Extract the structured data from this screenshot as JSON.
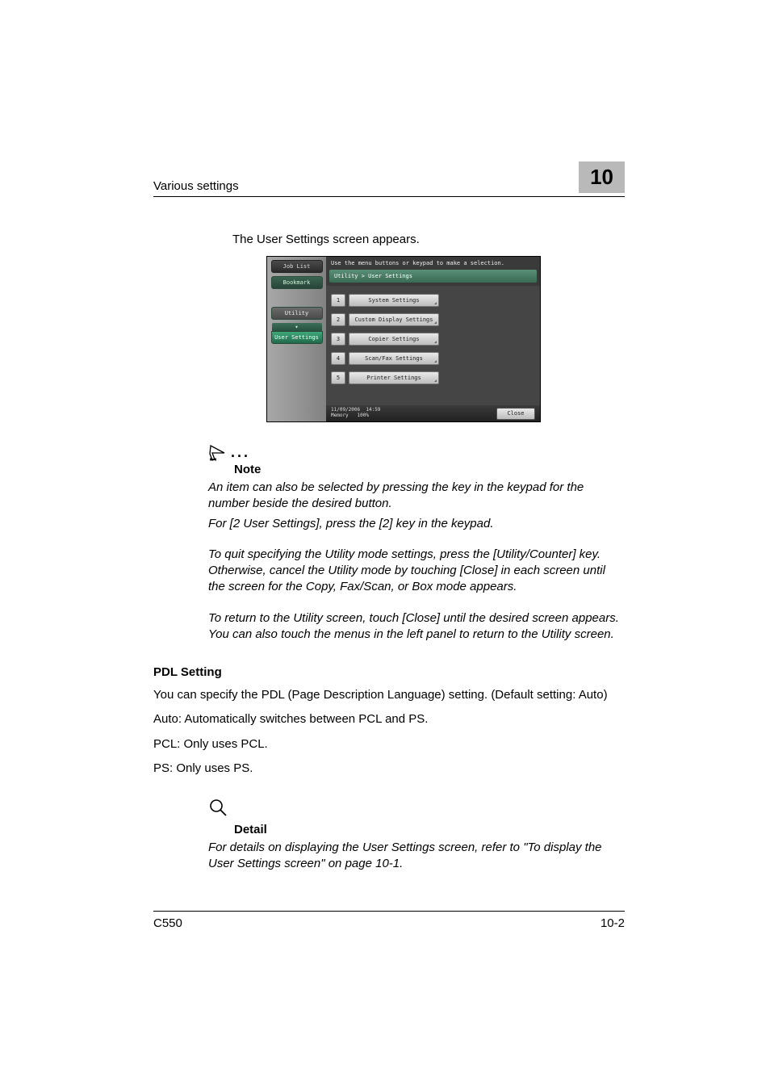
{
  "header": {
    "left": "Various settings",
    "right": "10"
  },
  "intro": "The User Settings screen appears.",
  "screenshot": {
    "left_tabs": {
      "job_list": "Job List",
      "bookmark": "Bookmark",
      "utility": "Utility",
      "arrow": "▾",
      "user_settings": "User Settings"
    },
    "topbar": "Use the menu buttons or keypad to make a selection.",
    "breadcrumb": "Utility > User Settings",
    "menu": [
      {
        "num": "1",
        "label": "System Settings"
      },
      {
        "num": "2",
        "label": "Custom Display Settings"
      },
      {
        "num": "3",
        "label": "Copier Settings"
      },
      {
        "num": "4",
        "label": "Scan/Fax Settings"
      },
      {
        "num": "5",
        "label": "Printer Settings"
      }
    ],
    "footer": {
      "date": "11/09/2006",
      "time": "14:59",
      "mem_label": "Memory",
      "mem_val": "100%",
      "close": "Close"
    }
  },
  "note": {
    "label": "Note",
    "p1": "An item can also be selected by pressing the key in the keypad for the number beside the desired button.",
    "p2": "For [2 User Settings], press the [2] key in the keypad.",
    "p3": "To quit specifying the Utility mode settings, press the [Utility/Counter] key. Otherwise, cancel the Utility mode by touching [Close] in each screen until the screen for the Copy, Fax/Scan, or Box mode appears.",
    "p4": "To return to the Utility screen, touch [Close] until the desired screen appears. You can also touch the menus in the left panel to return to the Utility screen."
  },
  "pdl": {
    "heading": "PDL Setting",
    "p1": "You can specify the PDL (Page Description Language) setting. (Default setting: Auto)",
    "p2": "Auto: Automatically switches between PCL and PS.",
    "p3": "PCL: Only uses PCL.",
    "p4": "PS: Only uses PS."
  },
  "detail": {
    "label": "Detail",
    "p1": "For details on displaying the User Settings screen, refer to \"To display the User Settings screen\" on page 10-1."
  },
  "footer": {
    "left": "C550",
    "right": "10-2"
  }
}
